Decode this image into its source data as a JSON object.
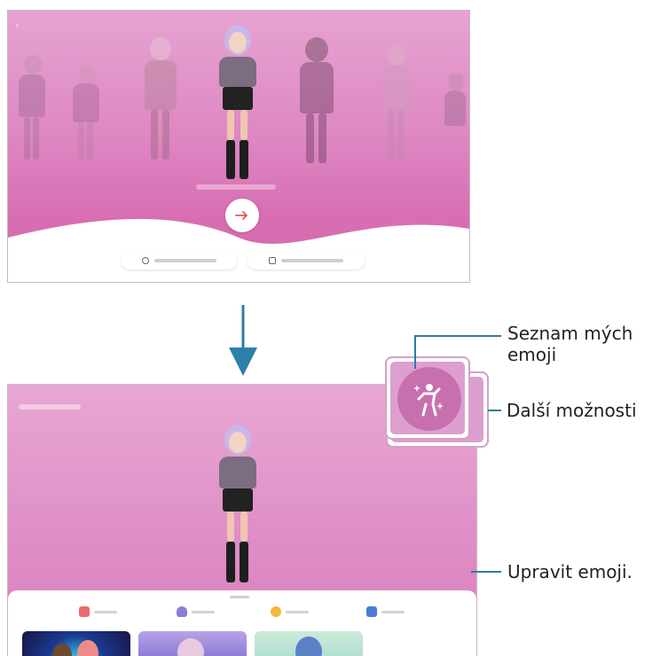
{
  "colors": {
    "accent_pink": "#d86fb2",
    "callout_border": "#d1a3c4",
    "leader_line": "#2a7ea0",
    "arrow_blue": "#2e7fa8",
    "next_arrow": "#e2555a"
  },
  "top_screen": {
    "back_icon": "chevron-left-icon",
    "next_icon": "arrow-right-icon"
  },
  "bottom_screen": {
    "tabs": [
      {
        "icon": "camera-icon",
        "color": "#f06a6a"
      },
      {
        "icon": "microphone-icon",
        "color": "#8f7ad8"
      },
      {
        "icon": "sticker-icon",
        "color": "#f2b93a"
      },
      {
        "icon": "gallery-icon",
        "color": "#4d7ad6"
      }
    ]
  },
  "callouts": {
    "my_emoji_list": "Seznam mých\nemoji",
    "more_options": "Další možnosti",
    "edit_emoji": "Upravit emoji."
  }
}
